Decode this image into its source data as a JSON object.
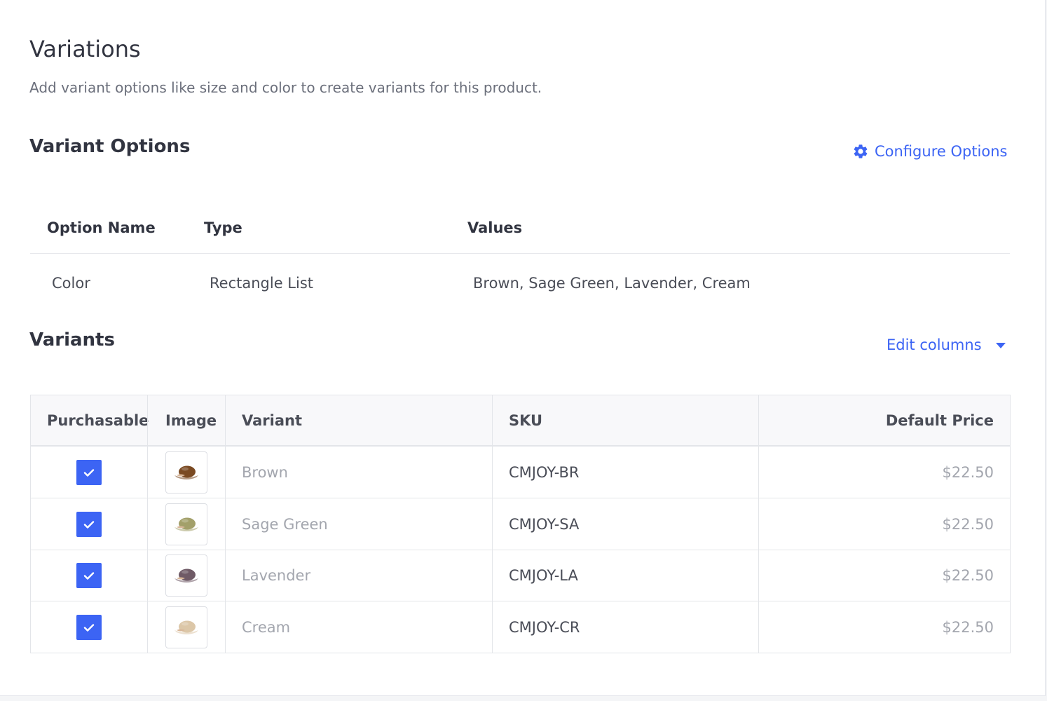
{
  "page": {
    "title": "Variations",
    "description": "Add variant options like size and color to create variants for this product."
  },
  "variant_options": {
    "title": "Variant Options",
    "configure_label": "Configure Options",
    "columns": {
      "name": "Option Name",
      "type": "Type",
      "values": "Values"
    },
    "rows": [
      {
        "name": "Color",
        "type": "Rectangle List",
        "values": "Brown, Sage Green, Lavender, Cream"
      }
    ]
  },
  "variants": {
    "title": "Variants",
    "edit_columns_label": "Edit columns",
    "columns": {
      "purchasable": "Purchasable",
      "image": "Image",
      "variant": "Variant",
      "sku": "SKU",
      "price": "Default Price"
    },
    "rows": [
      {
        "purchasable": true,
        "image_icon": "cap-brown-icon",
        "image_color": "#7a4a22",
        "variant": "Brown",
        "sku": "CMJOY-BR",
        "price": "$22.50"
      },
      {
        "purchasable": true,
        "image_icon": "cap-sage-green-icon",
        "image_color": "#a3a06a",
        "variant": "Sage Green",
        "sku": "CMJOY-SA",
        "price": "$22.50"
      },
      {
        "purchasable": true,
        "image_icon": "cap-lavender-icon",
        "image_color": "#6f5a66",
        "variant": "Lavender",
        "sku": "CMJOY-LA",
        "price": "$22.50"
      },
      {
        "purchasable": true,
        "image_icon": "cap-cream-icon",
        "image_color": "#dcc7a8",
        "variant": "Cream",
        "sku": "CMJOY-CR",
        "price": "$22.50"
      }
    ]
  },
  "colors": {
    "accent": "#3c64f4",
    "text_primary": "#313440",
    "text_muted": "#a3a6ae",
    "border": "#e3e5e9"
  }
}
